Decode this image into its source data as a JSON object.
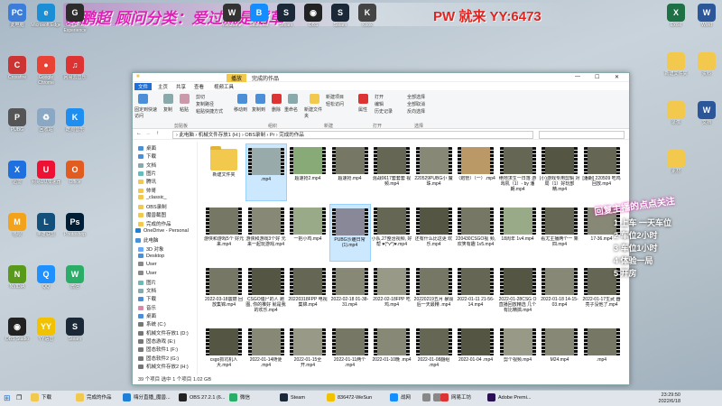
{
  "watermark": {
    "left": "@鹏超 顾问分类：爱过就是稻草",
    "right": "PW 就来 YY:6473"
  },
  "desktop_left": [
    {
      "label": "此电脑",
      "color": "#3b7dd8",
      "glyph": "PC"
    },
    {
      "label": "Microsoft Edge",
      "color": "#1b8fd6",
      "glyph": "e"
    },
    {
      "label": "GeForce Experience",
      "color": "#2c2c2c",
      "glyph": "G"
    },
    {
      "label": "Crossfire",
      "color": "#c33",
      "glyph": "C"
    },
    {
      "label": "Google Chrome",
      "color": "#e94235",
      "glyph": "●"
    },
    {
      "label": "网易云音乐",
      "color": "#d33",
      "glyph": "♫"
    },
    {
      "label": "PUBG",
      "color": "#555",
      "glyph": "P"
    },
    {
      "label": "回收站",
      "color": "#8aa8c4",
      "glyph": "♻"
    },
    {
      "label": "酷狗音乐",
      "color": "#1f8ef1",
      "glyph": "K"
    },
    {
      "label": "迅雷",
      "color": "#1e6fe0",
      "glyph": "X"
    },
    {
      "label": "网易UU加速器",
      "color": "#e13",
      "glyph": "U"
    },
    {
      "label": "Office",
      "color": "#e25b1f",
      "glyph": "O"
    },
    {
      "label": "猫眼",
      "color": "#f3a21b",
      "glyph": "M"
    },
    {
      "label": "英雄联盟",
      "color": "#13507c",
      "glyph": "L"
    },
    {
      "label": "Photoshop",
      "color": "#001e36",
      "glyph": "Ps"
    },
    {
      "label": "NVIDIA",
      "color": "#5a9a1a",
      "glyph": "N"
    },
    {
      "label": "QQ",
      "color": "#1e90ff",
      "glyph": "Q"
    },
    {
      "label": "微信",
      "color": "#2aae67",
      "glyph": "W"
    },
    {
      "label": "OBS Studio",
      "color": "#222",
      "glyph": "◉"
    },
    {
      "label": "YY语音",
      "color": "#f2c200",
      "glyph": "YY"
    },
    {
      "label": "Steam",
      "color": "#1b2838",
      "glyph": "S"
    }
  ],
  "desktop_top": [
    {
      "label": "WeGame",
      "color": "#333",
      "glyph": "W"
    },
    {
      "label": "Battle.net",
      "color": "#148eff",
      "glyph": "B"
    },
    {
      "label": "Steam",
      "color": "#1b2838",
      "glyph": "S"
    },
    {
      "label": "OBS",
      "color": "#222",
      "glyph": "◉"
    },
    {
      "label": "Steam",
      "color": "#1b2838",
      "glyph": "S"
    },
    {
      "label": "Kook",
      "color": "#444",
      "glyph": "K"
    }
  ],
  "desktop_right": [
    {
      "label": "Excel",
      "color": "#1e7145",
      "glyph": "X"
    },
    {
      "label": "Word",
      "color": "#2b579a",
      "glyph": "W"
    },
    {
      "label": "新建文件夹",
      "color": "#f2c94c",
      "glyph": ""
    },
    {
      "label": "资料",
      "color": "#f2c94c",
      "glyph": ""
    },
    {
      "label": "录像",
      "color": "#f2c94c",
      "glyph": ""
    },
    {
      "label": "文档",
      "color": "#2b579a",
      "glyph": "W"
    },
    {
      "label": "素材",
      "color": "#f2c94c",
      "glyph": ""
    }
  ],
  "explorer": {
    "title": "完成的作品",
    "quick_tab": "播放",
    "tabs": [
      "文件",
      "主页",
      "共享",
      "查看",
      "视频工具"
    ],
    "ribbon": {
      "pin": "固定到快速访问",
      "copy": "复制",
      "paste": "粘贴",
      "cut": "剪切",
      "copy_path": "复制路径",
      "paste_shortcut": "粘贴快捷方式",
      "move_to": "移动到",
      "copy_to": "复制到",
      "delete": "删除",
      "rename": "重命名",
      "new_folder": "新建文件夹",
      "new_item": "新建项目",
      "easy_access": "轻松访问",
      "properties": "属性",
      "open": "打开",
      "edit": "编辑",
      "history": "历史记录",
      "select_all": "全部选择",
      "select_none": "全部取消",
      "invert": "反向选择",
      "groups": [
        "剪贴板",
        "组织",
        "新建",
        "打开",
        "选择"
      ]
    },
    "breadcrumb": "› 此电脑 › 机械文件存放1 (H:) › OBS录制 › Pr › 完成的作品",
    "nav": [
      {
        "label": "桌面",
        "color": "#4a8fd8"
      },
      {
        "label": "下载",
        "color": "#4a8fd8"
      },
      {
        "label": "文档",
        "color": "#8aa"
      },
      {
        "label": "图片",
        "color": "#6bb"
      },
      {
        "label": "腾讯",
        "color": "#f2c94c"
      },
      {
        "label": "帅哥",
        "color": "#f2c94c"
      },
      {
        "label": "_classic_",
        "color": "#f2c94c"
      },
      {
        "label": "OBS录制",
        "color": "#f2c94c"
      },
      {
        "label": "魔兽截图",
        "color": "#f2c94c"
      },
      {
        "label": "完成的作品",
        "color": "#f2c94c"
      },
      {
        "label": "OneDrive - Personal",
        "color": "#1e7fd6"
      },
      {
        "label": "此电脑",
        "color": "#4a8fd8"
      },
      {
        "label": "3D 对象",
        "color": "#6af"
      },
      {
        "label": "Desktop",
        "color": "#4a8fd8"
      },
      {
        "label": "User",
        "color": "#888"
      },
      {
        "label": "User",
        "color": "#888"
      },
      {
        "label": "图片",
        "color": "#6bb"
      },
      {
        "label": "文档",
        "color": "#8aa"
      },
      {
        "label": "下载",
        "color": "#4a8fd8"
      },
      {
        "label": "音乐",
        "color": "#d8a"
      },
      {
        "label": "桌面",
        "color": "#4a8fd8"
      },
      {
        "label": "系统 (C:)",
        "color": "#777"
      },
      {
        "label": "机械文件存放1 (D:)",
        "color": "#777"
      },
      {
        "label": "固态游戏 (E:)",
        "color": "#777"
      },
      {
        "label": "固态软件1 (F:)",
        "color": "#777"
      },
      {
        "label": "固态软件2 (G:)",
        "color": "#777"
      },
      {
        "label": "机械文件存放2 (H:)",
        "color": "#777"
      }
    ],
    "files": [
      {
        "name": "新建文件夹",
        "type": "folder"
      },
      {
        "name": ".mp4",
        "type": "video",
        "selected": true,
        "bg": "#9aa"
      },
      {
        "name": "超速抢2.mp4",
        "type": "video",
        "bg": "#8a7"
      },
      {
        "name": "超速抢.mp4",
        "type": "video",
        "bg": "#776"
      },
      {
        "name": "混战0617套套套 视频.mp4",
        "type": "video",
        "bg": "#665"
      },
      {
        "name": "220529PUBG小 魔珠.mp4",
        "type": "video",
        "bg": "#887"
      },
      {
        "name": "（炮管）（一）.mp4",
        "type": "video",
        "bg": "#b96"
      },
      {
        "name": "绝地求生一日落 游戏机（1）- by 潘朗.mp4",
        "type": "video",
        "bg": "#665"
      },
      {
        "name": "(小)游戏专用剪辑 对局（1）好玩部 精.mp4",
        "type": "video",
        "bg": "#554"
      },
      {
        "name": "[潘朗] 220509 吃鸡回放.mp4",
        "type": "video",
        "bg": "#665"
      },
      {
        "name": "游侠和游戏5个 好元来.mp4",
        "type": "video",
        "bg": "#776"
      },
      {
        "name": "游侠和游戏3个好 元来一起玩游戏.mp4",
        "type": "video",
        "bg": "#887"
      },
      {
        "name": "一把小鸡.mp4",
        "type": "video",
        "bg": "#9a8"
      },
      {
        "name": "PUBG沙雕日常 (1).mp4",
        "type": "video",
        "selected": true,
        "bg": "#889"
      },
      {
        "name": "小队.27整治视频, 好帮 ♥(^v^)♥.mp4",
        "type": "video",
        "bg": "#665"
      },
      {
        "name": "还有什么比这更 欢乐.mp4",
        "type": "video",
        "bg": "#554"
      },
      {
        "name": "220430CSGO视 频, 欢笑有趣 1v5.mp4",
        "type": "video",
        "bg": "#776"
      },
      {
        "name": "18周年 1v4.mp4",
        "type": "video",
        "bg": "#9a8"
      },
      {
        "name": "看尤主播两个一 乘四.mp4",
        "type": "video",
        "bg": "#665"
      },
      {
        "name": "17-36.mp4",
        "type": "video",
        "bg": "#887"
      },
      {
        "name": "2022-03-18震撼 回放集锦.mp4",
        "type": "video",
        "bg": "#776"
      },
      {
        "name": "CSGO僵尸的人 跑图, 你的推好 就是我的欢乐.mp4",
        "type": "video",
        "bg": "#554"
      },
      {
        "name": "20220318FPP 电视集锦.mp4",
        "type": "video",
        "bg": "#665"
      },
      {
        "name": "2022-02-18 01-38-31.mp4",
        "type": "video",
        "bg": "#887"
      },
      {
        "name": "2022-02-18FPP 吃鸡.mp4",
        "type": "video",
        "bg": "#998"
      },
      {
        "name": "20220219五月 暴毁后一天最精 .mp4",
        "type": "video",
        "bg": "#776"
      },
      {
        "name": "2022-01-11 21-56-14.mp4",
        "type": "video",
        "bg": "#665"
      },
      {
        "name": "2022-01-28CSG O直播回放精选 几个有比精搞.mp4",
        "type": "video",
        "bg": "#554"
      },
      {
        "name": "2022-01-18 14-15-03.mp4",
        "type": "video",
        "bg": "#887"
      },
      {
        "name": "2022-01-17生武 器亮子没他了.mp4",
        "type": "video",
        "bg": "#665"
      },
      {
        "name": "csgo抓坑机人 大.mp4",
        "type": "video",
        "bg": "#554"
      },
      {
        "name": "2022-01-14随便 .mp4",
        "type": "video",
        "bg": "#887"
      },
      {
        "name": "2022-01-15全 开.mp4",
        "type": "video",
        "bg": "#998"
      },
      {
        "name": "2022-01-11两个 .mp4",
        "type": "video",
        "bg": "#776"
      },
      {
        "name": "2022-01-10晚 .mp4",
        "type": "video",
        "bg": "#887"
      },
      {
        "name": "2022-01-08翻组 .mp4",
        "type": "video",
        "bg": "#665"
      },
      {
        "name": "2022-01-04 .mp4",
        "type": "video",
        "bg": "#554"
      },
      {
        "name": "剪个视频.mp4",
        "type": "video",
        "bg": "#998"
      },
      {
        "name": "M24.mp4",
        "type": "video",
        "bg": "#887"
      },
      {
        "name": ".mp4",
        "type": "video",
        "bg": "#776"
      }
    ],
    "status": "39 个项目    选中 1 个项目  1.02 GB"
  },
  "overlay": {
    "headline": "回复主播的点点关注",
    "lines": [
      "1 上车 一天车位",
      "2 车位2小时",
      "3 车位1小时",
      "4 体验一局",
      "5 开房"
    ]
  },
  "taskbar": {
    "items": [
      {
        "label": "下载",
        "color": "#f2c94c"
      },
      {
        "label": "完成的作品",
        "color": "#f2c94c"
      },
      {
        "label": "嗨分直播_魔兽...",
        "color": "#1e7fd6"
      },
      {
        "label": "OBS 27.2.1 (6...",
        "color": "#222"
      },
      {
        "label": "微信",
        "color": "#2aae67"
      },
      {
        "label": "Steam",
        "color": "#1b2838"
      },
      {
        "label": "836472-WeSun",
        "color": "#f2c200"
      },
      {
        "label": "战网",
        "color": "#148eff"
      },
      {
        "label": "",
        "color": "#888"
      },
      {
        "label": "",
        "color": "#888"
      },
      {
        "label": "网易工坊",
        "color": "#d33"
      },
      {
        "label": "Adobe Premi...",
        "color": "#2a0f54"
      }
    ],
    "time": "23:29:50",
    "date": "2022/6/18"
  }
}
